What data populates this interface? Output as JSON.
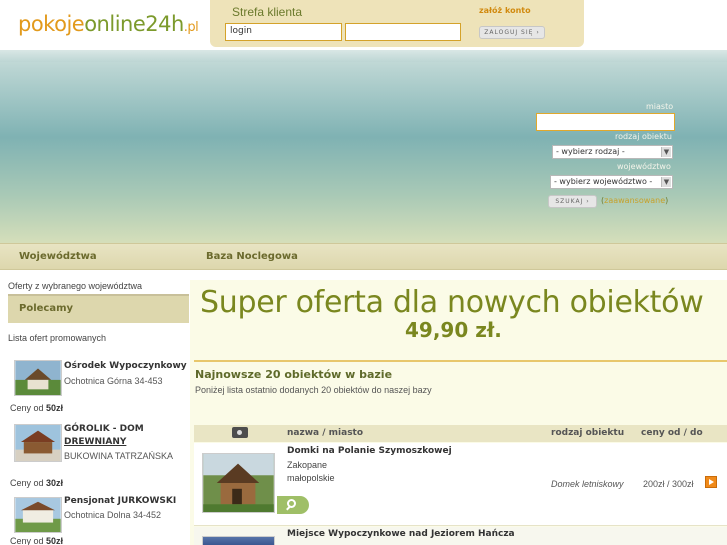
{
  "header": {
    "logo": {
      "part1": "pokoje",
      "part2": "online24h",
      "part3": ".pl"
    },
    "client_zone_title": "Strefa klienta",
    "register_link": "załóż konto",
    "login_value": "login",
    "password_value": "",
    "login_button": "ZALOGUJ SIĘ ›"
  },
  "search": {
    "city_label": "miasto",
    "city_value": "",
    "type_label": "rodzaj obiektu",
    "type_selected": "- wybierz rodzaj -",
    "region_label": "województwo",
    "region_selected": "- wybierz województwo -",
    "search_button": "SZUKAJ ›",
    "advanced_link": "zaawansowane",
    "open_paren": "(",
    "close_paren": ")"
  },
  "nav": {
    "items": [
      {
        "label": "Województwa"
      },
      {
        "label": "Baza Noclegowa"
      }
    ]
  },
  "sidebar": {
    "top_text": "Oferty z wybranego województwa",
    "promoted_header": "Polecamy",
    "promoted_sub": "Lista ofert promowanych",
    "items": [
      {
        "title": "Ośrodek Wypoczynkowy",
        "address": "Ochotnica Górna 34-453",
        "price_prefix": "Ceny od ",
        "price": "50zł"
      },
      {
        "title_line1": "GÓROLIK - DOM",
        "title_line2": "DREWNIANY",
        "address": "BUKOWINA TATRZAŃSKA",
        "price_prefix": "Ceny od ",
        "price": "30zł"
      },
      {
        "title": "Pensjonat JURKOWSKI",
        "address": "Ochotnica Dolna 34-452",
        "price_prefix": "Ceny od ",
        "price": "50zł"
      }
    ]
  },
  "main": {
    "super_offer": "Super oferta dla nowych obiektów",
    "super_price": "49,90 zł.",
    "newest_title": "Najnowsze 20 obiektów w bazie",
    "newest_sub": "Poniżej lista ostatnio dodanych 20 obiektów do naszej bazy",
    "table_headers": {
      "name": "nazwa / miasto",
      "type": "rodzaj obiektu",
      "price": "ceny od / do"
    },
    "rows": [
      {
        "name": "Domki na Polanie Szymoszkowej",
        "city": "Zakopane",
        "region": "małopolskie",
        "type": "Domek letniskowy",
        "price": "200zł / 300zł"
      },
      {
        "name": "Miejsce Wypoczynkowe nad Jeziorem Hańcza"
      }
    ]
  },
  "colors": {
    "accent_orange": "#e29a1c",
    "accent_green": "#7a871f",
    "nav_bg": "#ddd7ad"
  }
}
